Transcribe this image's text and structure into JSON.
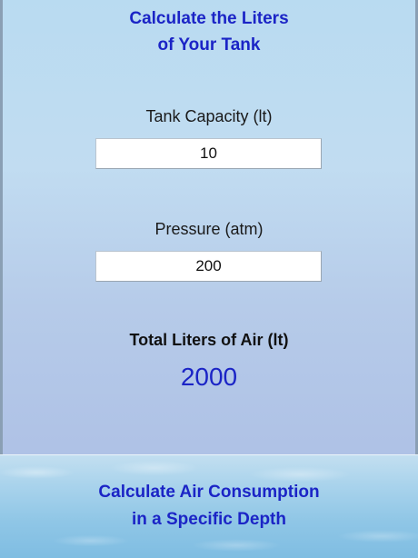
{
  "header": {
    "title_line1": "Calculate the Liters",
    "title_line2": "of Your Tank"
  },
  "form": {
    "capacity_label": "Tank Capacity (lt)",
    "capacity_value": "10",
    "pressure_label": "Pressure (atm)",
    "pressure_value": "200"
  },
  "result": {
    "label": "Total Liters of Air (lt)",
    "value": "2000"
  },
  "footer_link": {
    "line1": "Calculate Air Consumption",
    "line2": "in a Specific Depth"
  },
  "colors": {
    "accent": "#1b24c6",
    "text": "#111111",
    "field_bg": "#ffffff"
  }
}
